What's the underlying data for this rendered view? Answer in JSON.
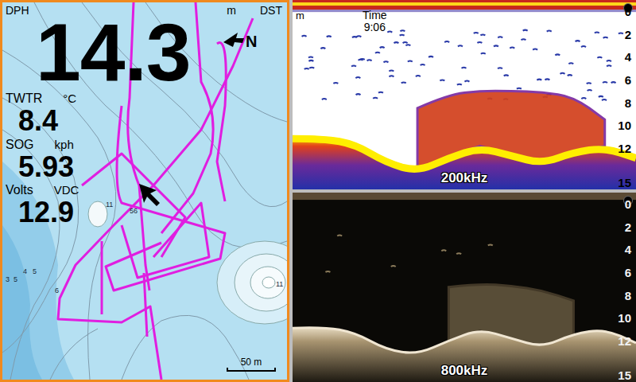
{
  "map": {
    "depth_label": "DPH",
    "depth_unit": "m",
    "distance_label": "DST",
    "depth": "14.3",
    "north": "N",
    "readouts": [
      {
        "label": "TWTR",
        "unit": "°C",
        "value": "8.4"
      },
      {
        "label": "SOG",
        "unit": "kph",
        "value": "5.93"
      },
      {
        "label": "Volts",
        "unit": "VDC",
        "value": "12.9"
      }
    ],
    "scale": "50 m",
    "soundings": [
      "3",
      "5",
      "4",
      "5",
      "6",
      "11",
      "56",
      "11"
    ]
  },
  "sonar": [
    {
      "kind": "broadband",
      "frequency": "200kHz",
      "unit": "m",
      "time_label": "Time",
      "time": "9:06",
      "scale": [
        "0",
        "2",
        "4",
        "6",
        "8",
        "10",
        "12",
        "15"
      ],
      "bottom": [
        10.9,
        10.9,
        11.4,
        13.0,
        13.8,
        12.6,
        11.7,
        12.4,
        13.1,
        12.1,
        11.7,
        12.6
      ],
      "school_top": [
        null,
        null,
        null,
        null,
        8.5,
        7.3,
        7.0,
        7.0,
        7.1,
        7.5,
        9.5,
        null
      ]
    },
    {
      "kind": "downscan",
      "frequency": "800kHz",
      "scale": [
        "0",
        "2",
        "4",
        "6",
        "8",
        "10",
        "12",
        "15"
      ],
      "bottom": [
        10.9,
        10.8,
        11.3,
        12.8,
        13.2,
        12.0,
        11.0,
        11.8,
        12.6,
        11.4,
        11.0,
        12.2
      ],
      "school_top": [
        null,
        null,
        null,
        null,
        null,
        7.3,
        7.0,
        7.2,
        7.6,
        8.5,
        null,
        null
      ]
    }
  ]
}
